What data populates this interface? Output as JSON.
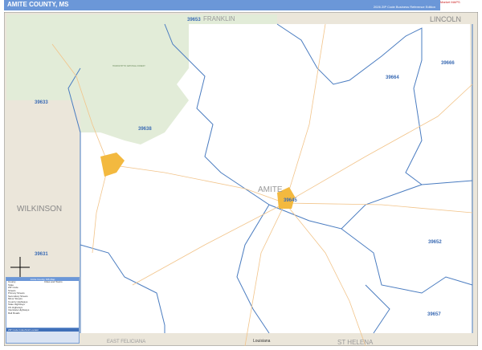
{
  "header": {
    "title": "AMITE COUNTY, MS",
    "edition": "2026 ZIP Code Business Reference Edition",
    "logo": "Market MAPS"
  },
  "map": {
    "neighbors": [
      "FRANKLIN",
      "LINCOLN",
      "WILKINSON",
      "EAST FELICIANA",
      "ST HELENA"
    ],
    "state_label": "Louisiana",
    "city": "AMITE",
    "forest": "HOMOCHITTO NATIONAL FOREST",
    "zips": [
      "39653",
      "39664",
      "39666",
      "39633",
      "39638",
      "39645",
      "39652",
      "39657",
      "39631"
    ],
    "colors": {
      "county": "#ffffff",
      "outside": "#ebe6da",
      "forest": "#e2ecd8",
      "zip_line": "#4a7cc0",
      "road": "#f2c48a",
      "city": "#f3b93f",
      "header": "#6b97d8"
    }
  },
  "legend": {
    "title": "Amite County, MS Map",
    "items": [
      "County",
      "State",
      "ZIP Code",
      "Streets",
      "Primary Streets",
      "Secondary Streets",
      "Minor Streets",
      "Country Highways",
      "State Highways",
      "US Highways",
      "Interstate Highways",
      "Rail Roads"
    ],
    "pop_title": "Cities and Towns"
  },
  "zip_index": {
    "title": "ZIP Code Index/Grid Locator"
  }
}
